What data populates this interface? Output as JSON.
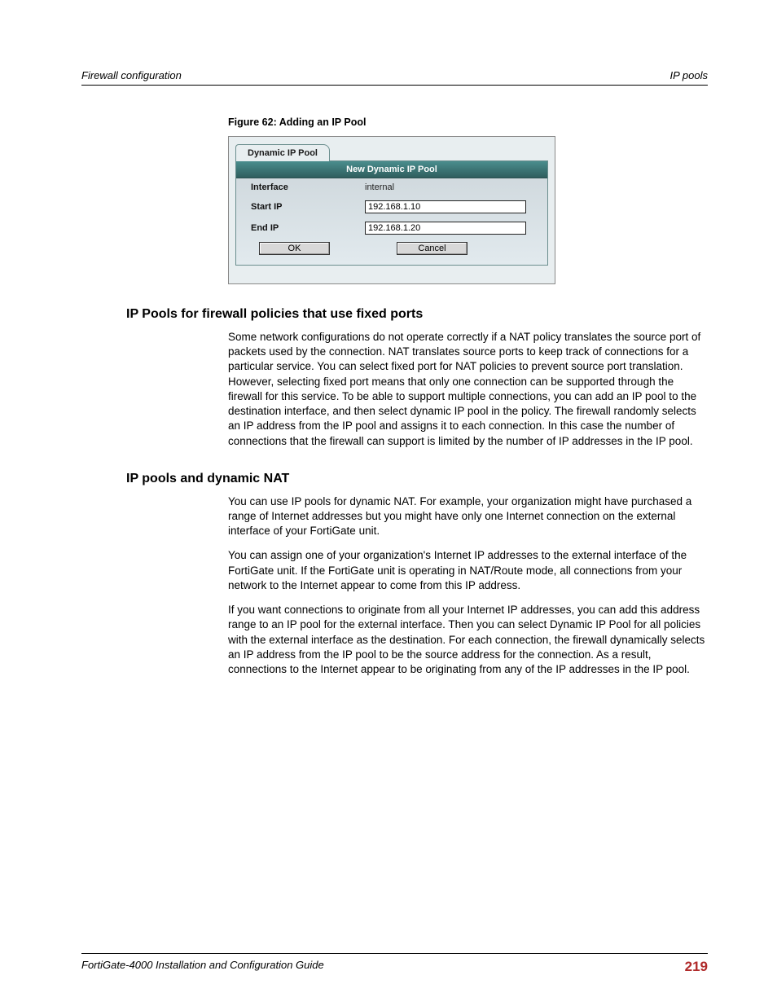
{
  "header": {
    "left": "Firewall configuration",
    "right": "IP pools"
  },
  "figure": {
    "caption": "Figure 62: Adding an IP Pool",
    "tab": "Dynamic IP Pool",
    "title": "New Dynamic IP Pool",
    "rows": {
      "interface_label": "Interface",
      "interface_value": "internal",
      "startip_label": "Start IP",
      "startip_value": "192.168.1.10",
      "endip_label": "End IP",
      "endip_value": "192.168.1.20"
    },
    "buttons": {
      "ok": "OK",
      "cancel": "Cancel"
    }
  },
  "section1": {
    "heading": "IP Pools for firewall policies that use fixed ports",
    "p1": "Some network configurations do not operate correctly if a NAT policy translates the source port of packets used by the connection. NAT translates source ports to keep track of connections for a particular service. You can select fixed port for NAT policies to prevent source port translation. However, selecting fixed port means that only one connection can be supported through the firewall for this service. To be able to support multiple connections, you can add an IP pool to the destination interface, and then select dynamic IP pool in the policy. The firewall randomly selects an IP address from the IP pool and assigns it to each connection. In this case the number of connections that the firewall can support is limited by the number of IP addresses in the IP pool."
  },
  "section2": {
    "heading": "IP pools and dynamic NAT",
    "p1": "You can use IP pools for dynamic NAT. For example, your organization might have purchased a range of Internet addresses but you might have only one Internet connection on the external interface of your FortiGate unit.",
    "p2": "You can assign one of your organization's Internet IP addresses to the external interface of the FortiGate unit. If the FortiGate unit is operating in NAT/Route mode, all connections from your network to the Internet appear to come from this IP address.",
    "p3": "If you want connections to originate from all your Internet IP addresses, you can add this address range to an IP pool for the external interface. Then you can select Dynamic IP Pool for all policies with the external interface as the destination. For each connection, the firewall dynamically selects an IP address from the IP pool to be the source address for the connection. As a result, connections to the Internet appear to be originating from any of the IP addresses in the IP pool."
  },
  "footer": {
    "title": "FortiGate-4000 Installation and Configuration Guide",
    "page": "219"
  }
}
